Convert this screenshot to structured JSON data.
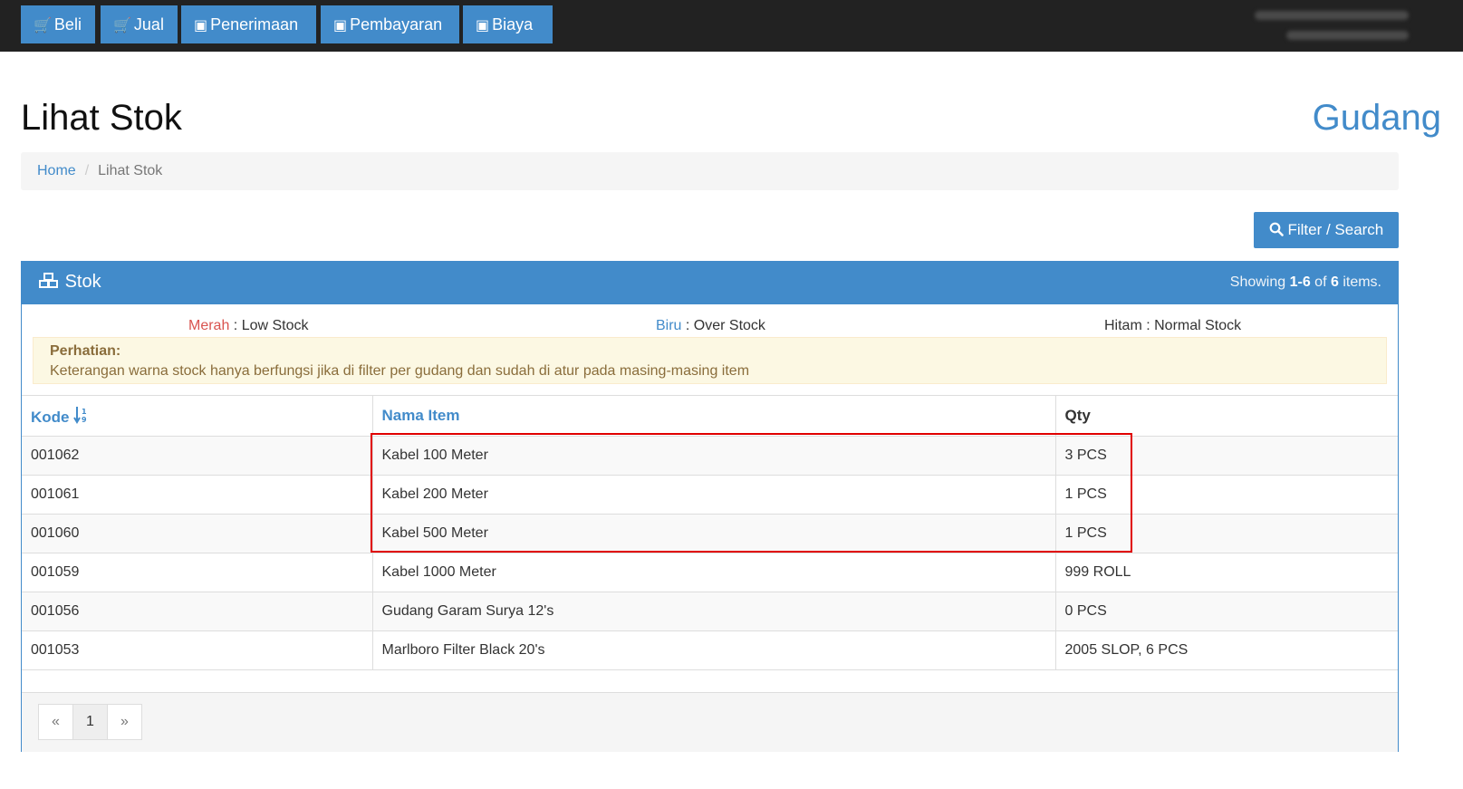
{
  "nav": {
    "buttons": [
      {
        "label": "Beli",
        "icon": "cart-icon"
      },
      {
        "label": "Jual",
        "icon": "cart-icon"
      },
      {
        "label": "Penerimaan",
        "icon": "money-icon"
      },
      {
        "label": "Pembayaran",
        "icon": "money-icon"
      },
      {
        "label": "Biaya",
        "icon": "money-icon"
      }
    ]
  },
  "page": {
    "title": "Lihat Stok",
    "brand": "Gudang"
  },
  "breadcrumb": {
    "home": "Home",
    "current": "Lihat Stok"
  },
  "filter_button": {
    "label": "Filter / Search"
  },
  "panel": {
    "title": "Stok",
    "summary_prefix": "Showing ",
    "summary_range": "1-6",
    "summary_mid": " of ",
    "summary_total": "6",
    "summary_suffix": " items."
  },
  "legend": {
    "red_label": "Merah",
    "red_desc": " : Low Stock",
    "blue_label": "Biru",
    "blue_desc": " : Over Stock",
    "black_label": "Hitam",
    "black_desc": " : Normal Stock"
  },
  "alert": {
    "title": "Perhatian:",
    "message": "Keterangan warna stock hanya berfungsi jika di filter per gudang dan sudah di atur pada masing-masing item"
  },
  "table": {
    "headers": {
      "kode": "Kode",
      "nama": "Nama Item",
      "qty": "Qty"
    },
    "rows": [
      {
        "kode": "001062",
        "nama": "Kabel 100 Meter",
        "qty": "3 PCS"
      },
      {
        "kode": "001061",
        "nama": "Kabel 200 Meter",
        "qty": "1 PCS"
      },
      {
        "kode": "001060",
        "nama": "Kabel 500 Meter",
        "qty": "1 PCS"
      },
      {
        "kode": "001059",
        "nama": "Kabel 1000 Meter",
        "qty": "999 ROLL"
      },
      {
        "kode": "001056",
        "nama": "Gudang Garam Surya 12's",
        "qty": "0 PCS"
      },
      {
        "kode": "001053",
        "nama": "Marlboro Filter Black 20's",
        "qty": "2005 SLOP, 6 PCS"
      }
    ]
  },
  "pagination": {
    "prev": "«",
    "page": "1",
    "next": "»"
  },
  "colors": {
    "primary": "#428bca",
    "navbar": "#222222",
    "highlight": "#e00000",
    "low_stock": "#d9534f"
  }
}
